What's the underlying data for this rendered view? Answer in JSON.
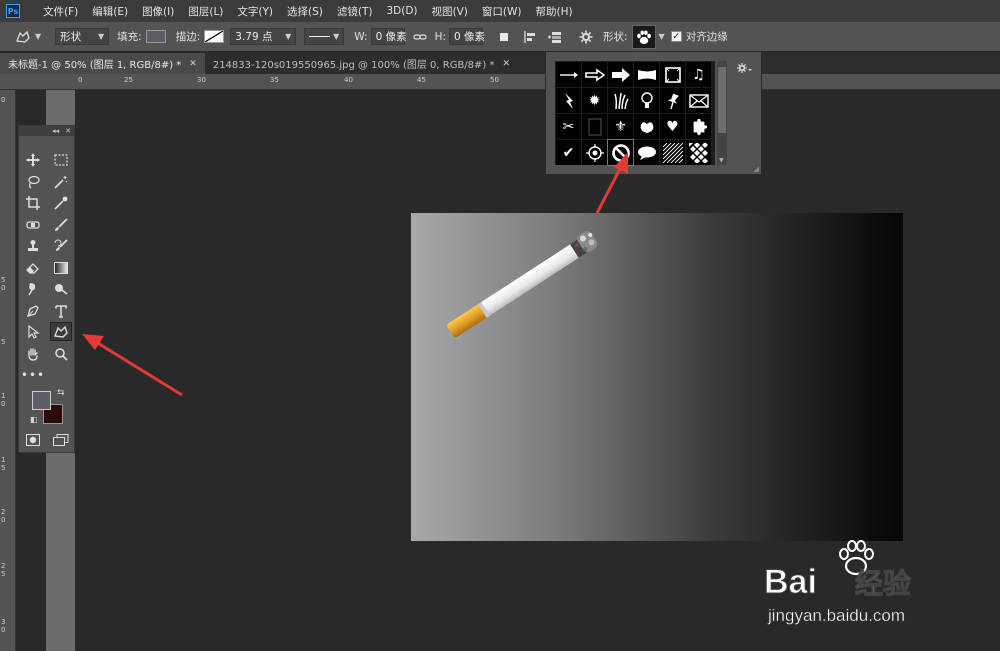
{
  "app": {
    "logo": "Ps"
  },
  "menu": [
    "文件(F)",
    "编辑(E)",
    "图像(I)",
    "图层(L)",
    "文字(Y)",
    "选择(S)",
    "滤镜(T)",
    "3D(D)",
    "视图(V)",
    "窗口(W)",
    "帮助(H)"
  ],
  "options": {
    "mode": "形状",
    "fill_label": "填充:",
    "stroke_label": "描边:",
    "stroke_width": "3.79 点",
    "w_label": "W:",
    "w_value": "0 像素",
    "h_label": "H:",
    "h_value": "0 像素",
    "shape_label": "形状:",
    "align_edges_label": "对齐边缘",
    "fill_color": "#5e5c66"
  },
  "tabs": [
    {
      "label": "未标题-1 @ 50% (图层 1, RGB/8#) *"
    },
    {
      "label": "214833-120s019550965.jpg @ 100% (图层 0, RGB/8#) *"
    }
  ],
  "ruler": {
    "top": [
      "0",
      "25",
      "30",
      "35",
      "40",
      "45",
      "50"
    ],
    "left": [
      "0",
      "5",
      "0",
      "5",
      "1",
      "0",
      "1",
      "5",
      "2",
      "0",
      "2",
      "5",
      "3",
      "0"
    ]
  },
  "colors": {
    "foreground": "#5e5c66",
    "background": "#2a0a0c",
    "arrow": "#e53935"
  },
  "watermark": {
    "brand": "Bai",
    "brand_cn": "经验",
    "url": "jingyan.baidu.com"
  }
}
